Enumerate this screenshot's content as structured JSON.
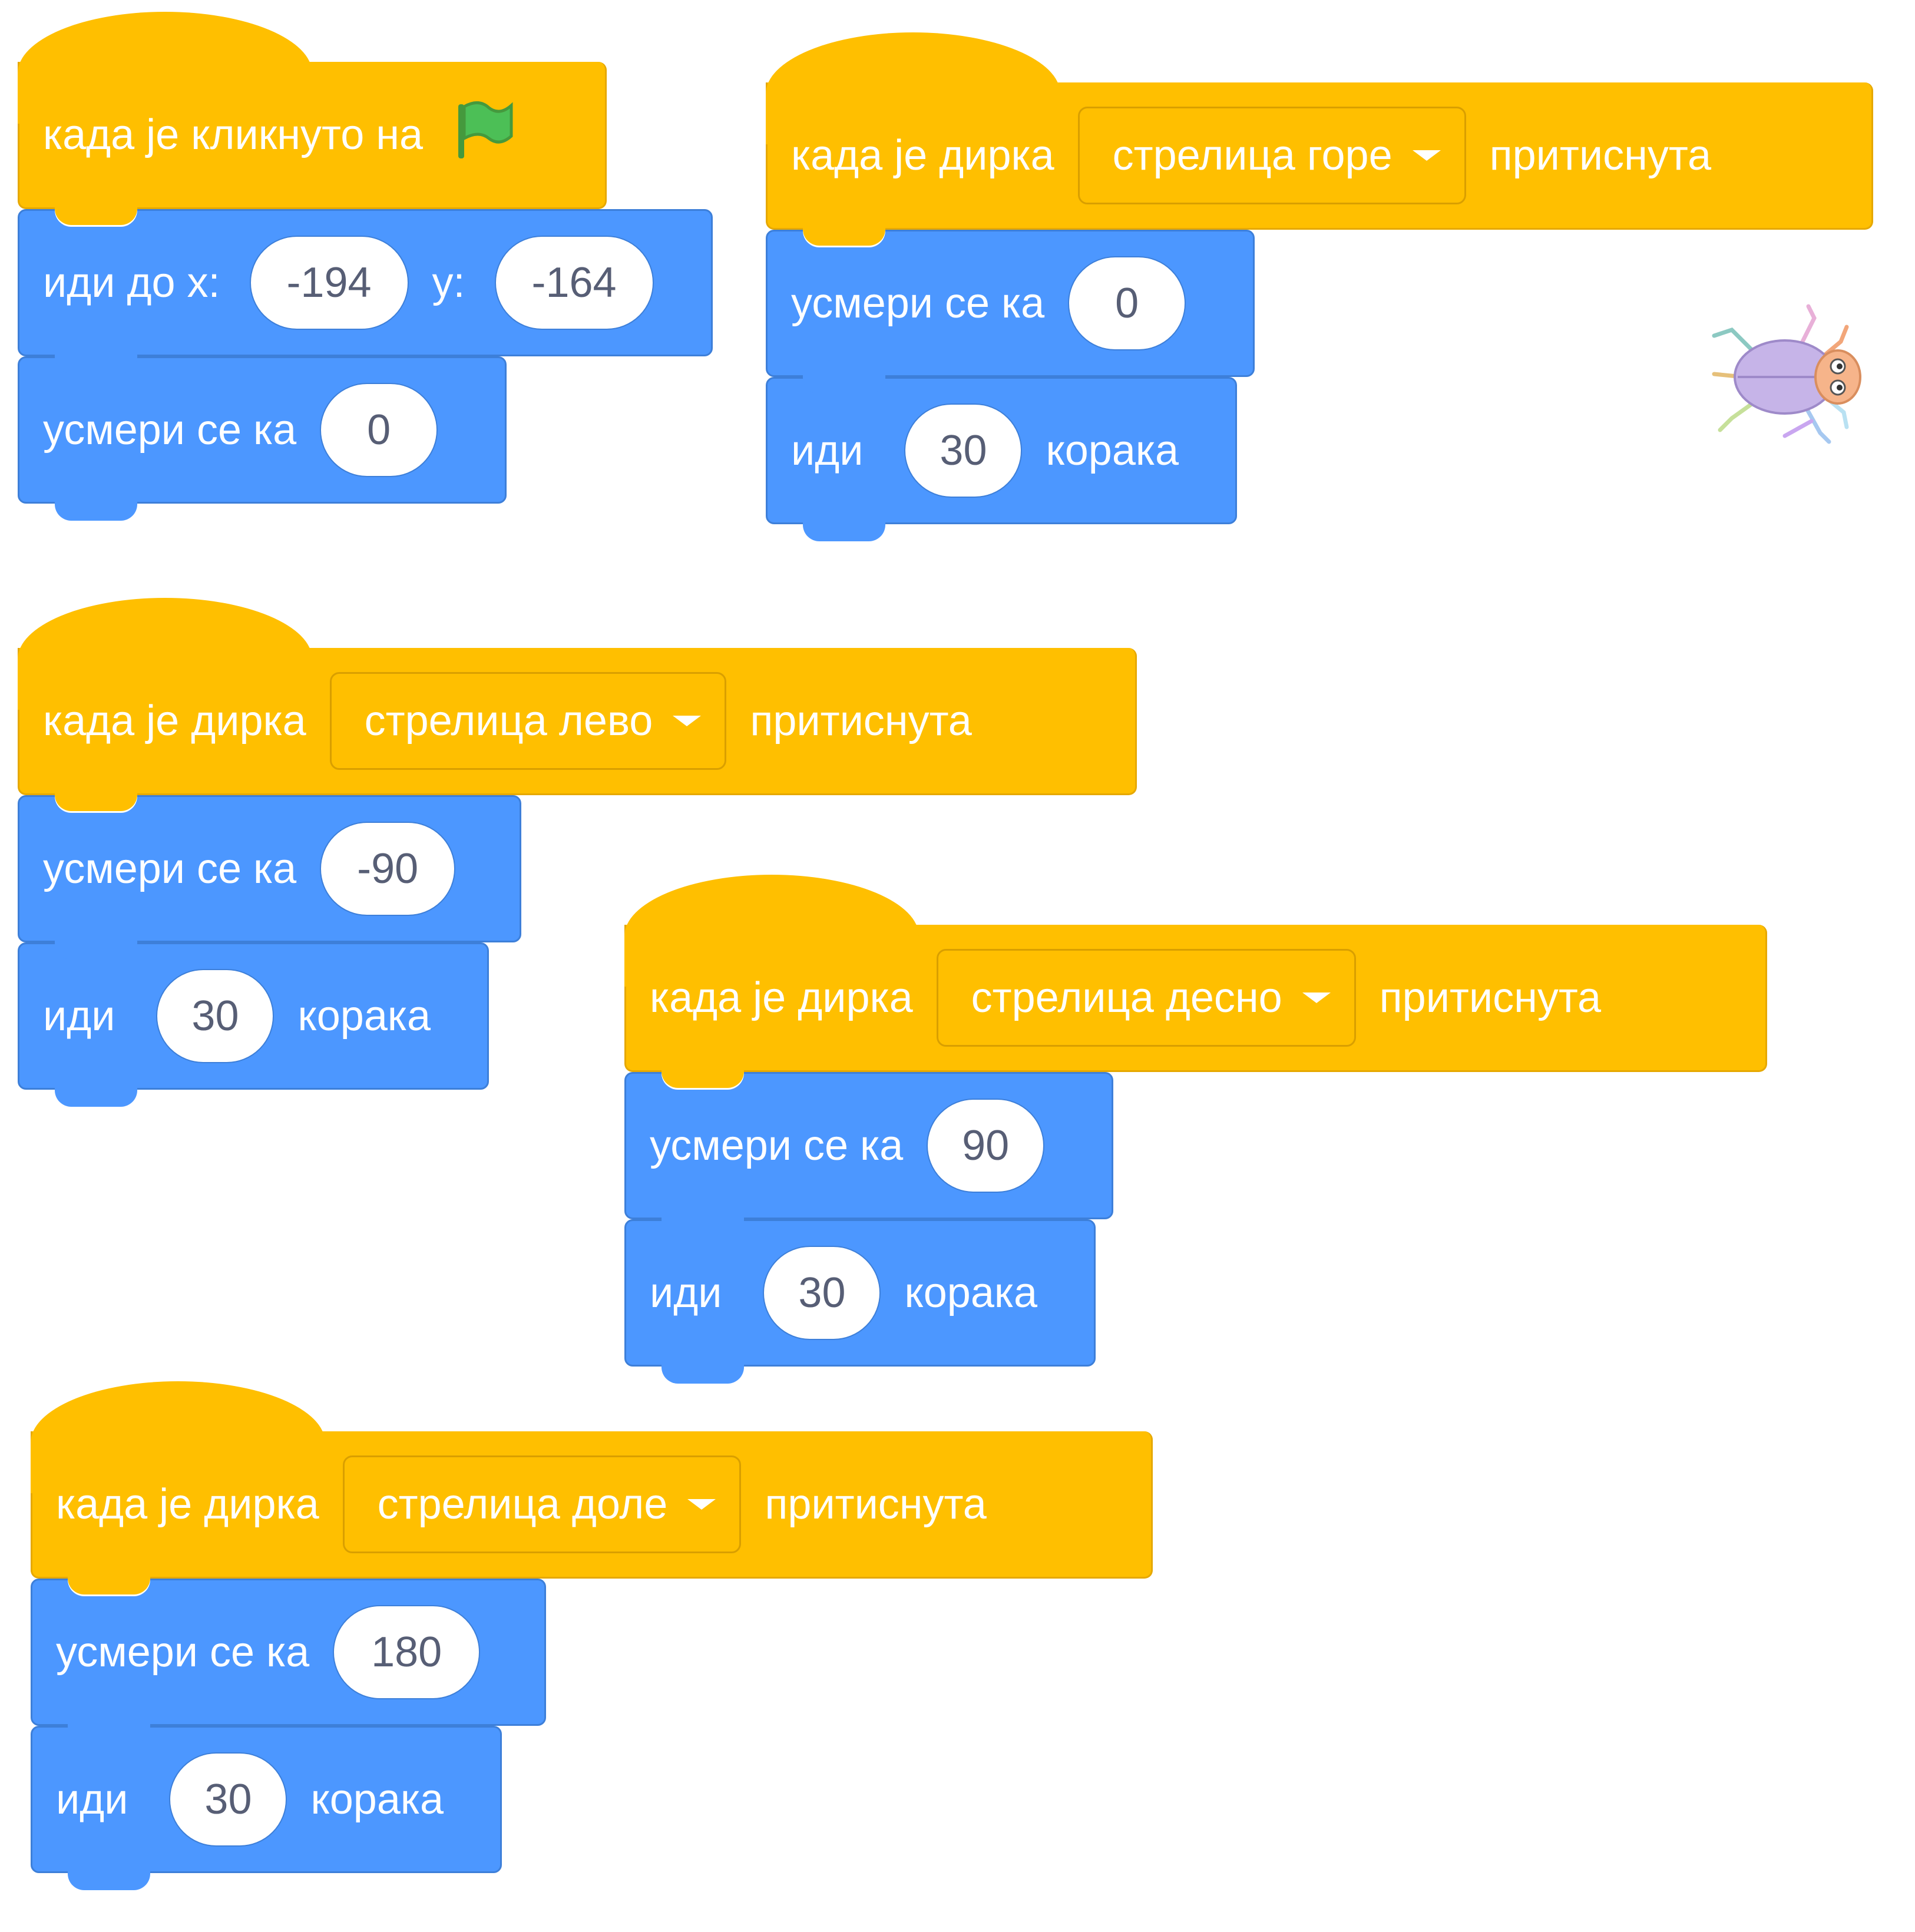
{
  "green_flag_script": {
    "hat_label": "када је кликнуто на",
    "goto_label": "иди до x:",
    "goto_x": "-194",
    "goto_y_label": "y:",
    "goto_y": "-164",
    "point_label": "усмери се ка",
    "point_value": "0"
  },
  "key_scripts": [
    {
      "hat_prefix": "када је дирка",
      "key": "стрелица горе",
      "hat_suffix": "притиснута",
      "point_label": "усмери се ка",
      "point_value": "0",
      "move_label": "иди",
      "move_value": "30",
      "move_suffix": "корака"
    },
    {
      "hat_prefix": "када је дирка",
      "key": "стрелица лево",
      "hat_suffix": "притиснута",
      "point_label": "усмери се ка",
      "point_value": "-90",
      "move_label": "иди",
      "move_value": "30",
      "move_suffix": "корака"
    },
    {
      "hat_prefix": "када је дирка",
      "key": "стрелица десно",
      "hat_suffix": "притиснута",
      "point_label": "усмери се ка",
      "point_value": "90",
      "move_label": "иди",
      "move_value": "30",
      "move_suffix": "корака"
    },
    {
      "hat_prefix": "када је дирка",
      "key": "стрелица доле",
      "hat_suffix": "притиснута",
      "point_label": "усмери се ка",
      "point_value": "180",
      "move_label": "иди",
      "move_value": "30",
      "move_suffix": "корака"
    }
  ],
  "icons": {
    "flag": "green-flag-icon",
    "sprite": "beetle-sprite-icon",
    "caret": "caret-down-icon"
  },
  "colors": {
    "events": "#FFBF00",
    "motion": "#4C97FF",
    "input_text": "#575E75",
    "flag": "#4CBF56"
  }
}
